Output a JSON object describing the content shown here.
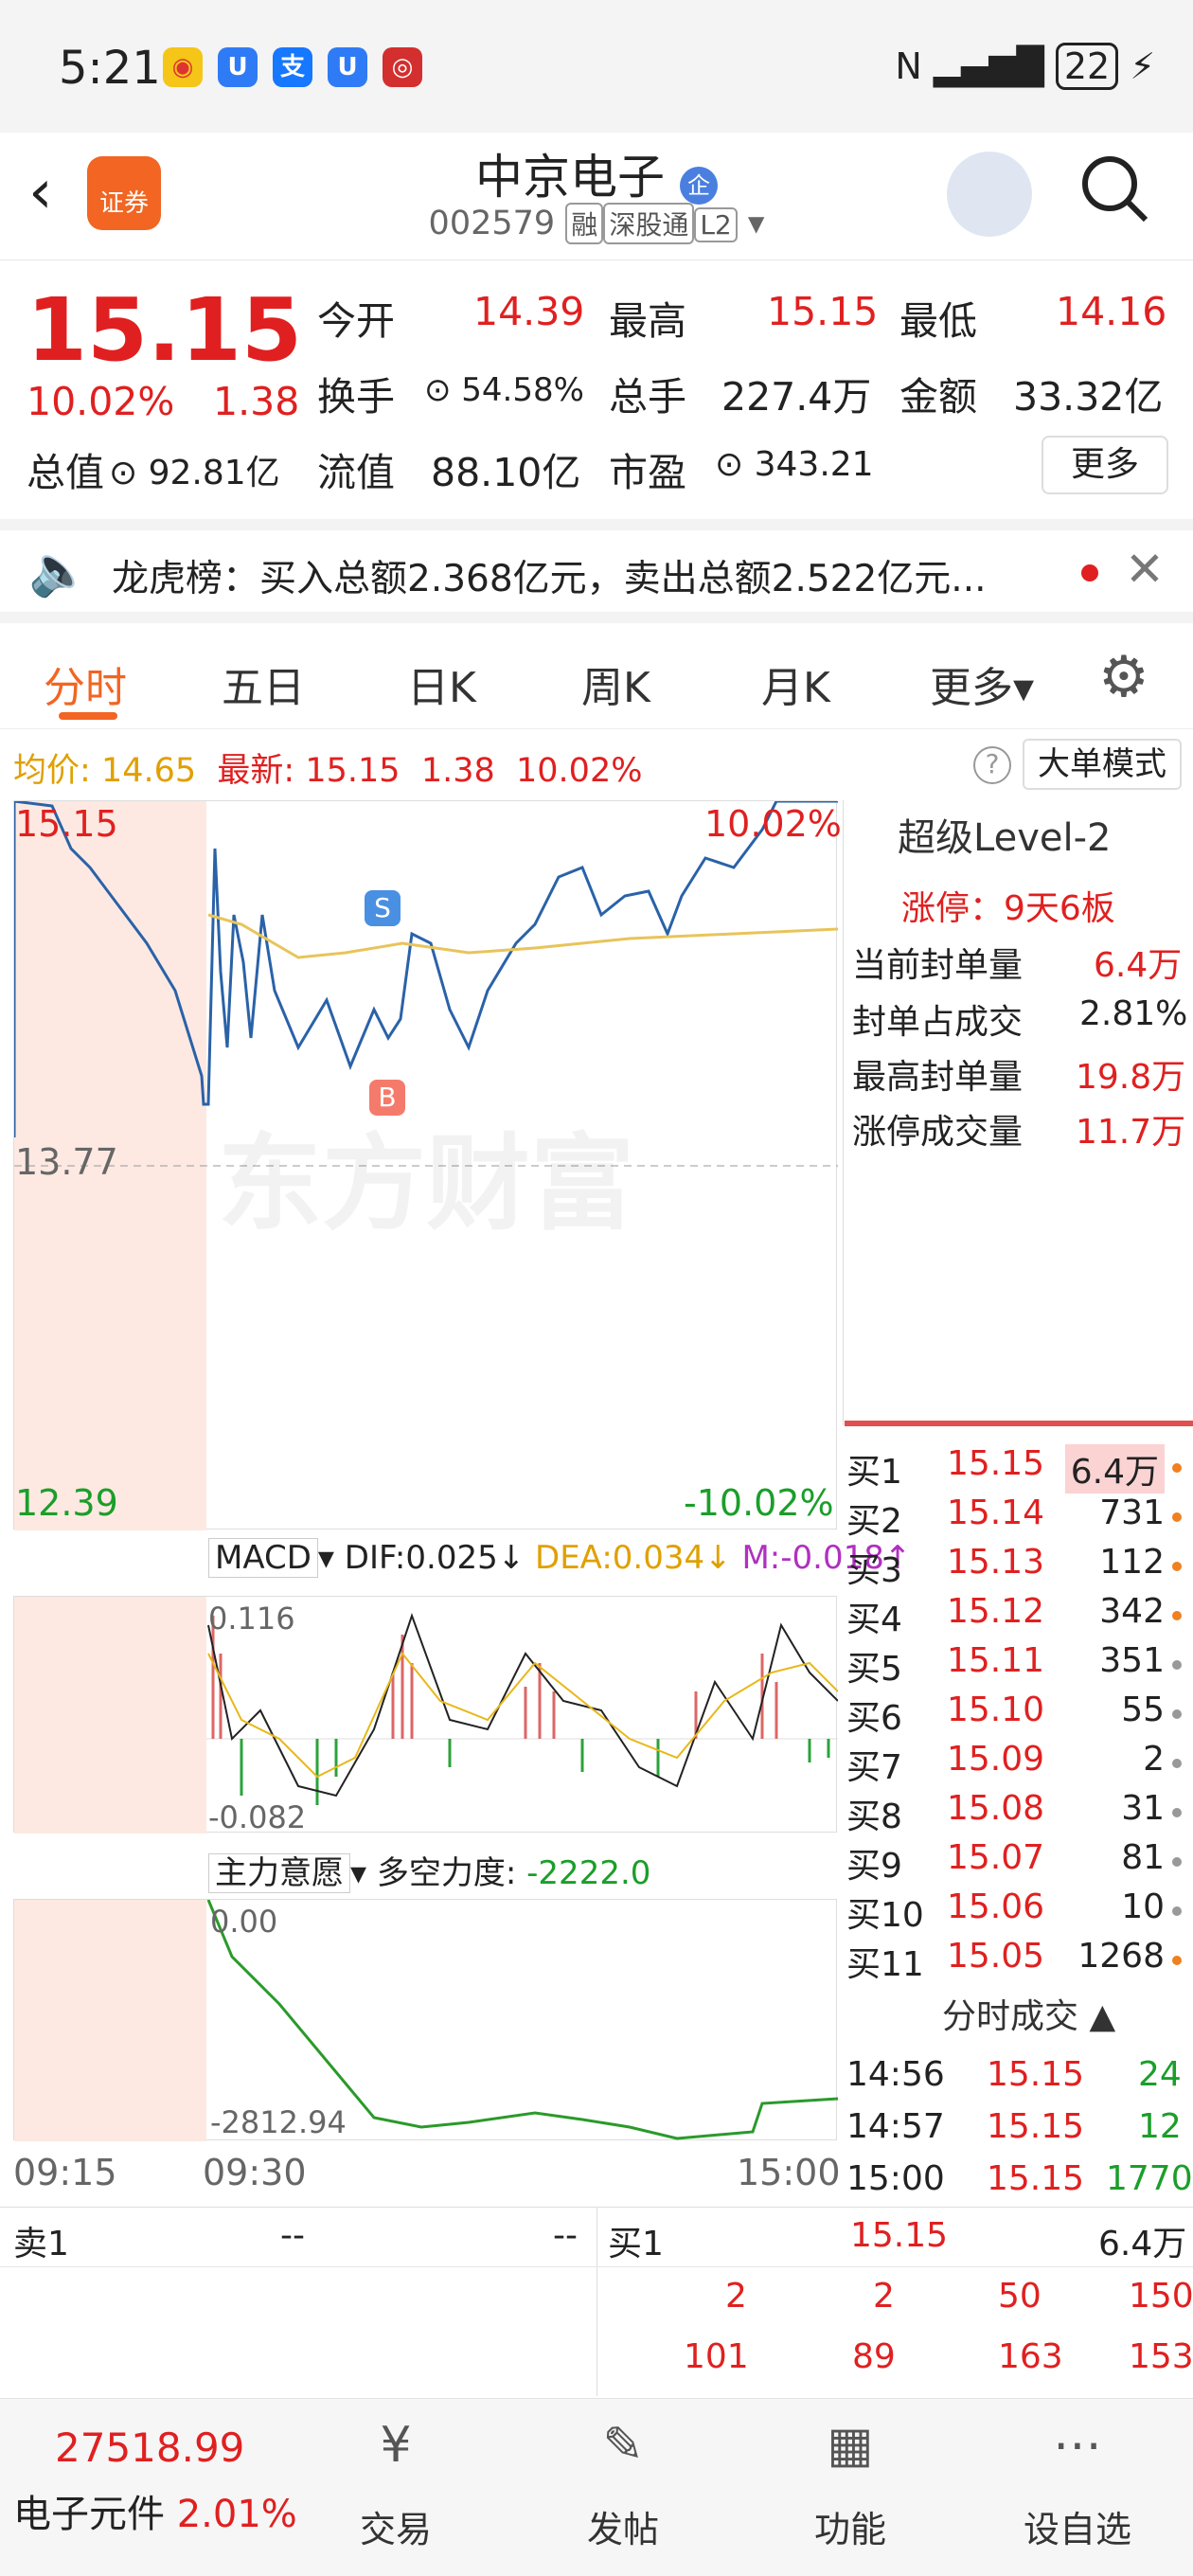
{
  "status_bar": {
    "time": "5:21",
    "battery": "22"
  },
  "header": {
    "title": "中京电子",
    "code": "002579",
    "tags": [
      "融",
      "深股通",
      "L2"
    ]
  },
  "quote": {
    "price": "15.15",
    "change_pct": "10.02%",
    "change": "1.38",
    "open_label": "今开",
    "open": "14.39",
    "high_label": "最高",
    "high": "15.15",
    "low_label": "最低",
    "low": "14.16",
    "turnover_label": "换手",
    "turnover": "54.58%",
    "volume_label": "总手",
    "volume": "227.4万",
    "amount_label": "金额",
    "amount": "33.32亿",
    "mcap_label": "总值",
    "mcap": "92.81亿",
    "float_label": "流值",
    "float": "88.10亿",
    "pe_label": "市盈",
    "pe": "343.21",
    "more_button": "更多"
  },
  "notice": {
    "text": "龙虎榜：买入总额2.368亿元，卖出总额2.522亿元..."
  },
  "tabs": [
    "分时",
    "五日",
    "日K",
    "周K",
    "月K",
    "更多"
  ],
  "chart_info": {
    "avg_label": "均价:",
    "avg": "14.65",
    "latest_label": "最新:",
    "latest": "15.15",
    "chg": "1.38",
    "pct": "10.02%",
    "mode_button": "大单模式"
  },
  "chart_labels": {
    "top_price": "15.15",
    "mid_price": "13.77",
    "bottom_price": "12.39",
    "top_pct": "10.02%",
    "bottom_pct": "-10.02%",
    "watermark": "东方财富"
  },
  "macd": {
    "label": "MACD",
    "dif": "DIF:0.025",
    "dea": "DEA:0.034",
    "m": "M:-0.018",
    "top": "0.116",
    "bottom": "-0.082"
  },
  "zlyy": {
    "label": "主力意愿",
    "force": "多空力度:",
    "force_val": "-2222.0",
    "top": "0.00",
    "bottom": "-2812.94"
  },
  "time_axis": [
    "09:15",
    "09:30",
    "15:00"
  ],
  "level2": {
    "title": "超级Level-2",
    "limit": "涨停：9天6板",
    "rows": [
      {
        "k": "当前封单量",
        "v": "6.4万"
      },
      {
        "k": "封单占成交",
        "v": "2.81%"
      },
      {
        "k": "最高封单量",
        "v": "19.8万"
      },
      {
        "k": "涨停成交量",
        "v": "11.7万"
      }
    ]
  },
  "orderbook": [
    {
      "l": "买1",
      "p": "15.15",
      "v": "6.4万"
    },
    {
      "l": "买2",
      "p": "15.14",
      "v": "731"
    },
    {
      "l": "买3",
      "p": "15.13",
      "v": "112"
    },
    {
      "l": "买4",
      "p": "15.12",
      "v": "342"
    },
    {
      "l": "买5",
      "p": "15.11",
      "v": "351"
    },
    {
      "l": "买6",
      "p": "15.10",
      "v": "55"
    },
    {
      "l": "买7",
      "p": "15.09",
      "v": "2"
    },
    {
      "l": "买8",
      "p": "15.08",
      "v": "31"
    },
    {
      "l": "买9",
      "p": "15.07",
      "v": "81"
    },
    {
      "l": "买10",
      "p": "15.06",
      "v": "10"
    },
    {
      "l": "买11",
      "p": "15.05",
      "v": "1268"
    }
  ],
  "ticks_title": "分时成交",
  "ticks": [
    {
      "t": "14:56",
      "p": "15.15",
      "v": "24"
    },
    {
      "t": "14:57",
      "p": "15.15",
      "v": "12"
    },
    {
      "t": "15:00",
      "p": "15.15",
      "v": "1770"
    }
  ],
  "queue": {
    "sell_label": "卖1",
    "sell_p": "--",
    "sell_v": "--",
    "buy_label": "买1",
    "buy_p": "15.15",
    "buy_v": "6.4万",
    "row1": [
      "2",
      "2",
      "50",
      "150"
    ],
    "row2": [
      "101",
      "89",
      "163",
      "153"
    ]
  },
  "bottom": {
    "index": "27518.99",
    "sector": "电子元件",
    "sector_pct": "2.01%",
    "nav": [
      "交易",
      "发帖",
      "功能",
      "设自选"
    ]
  }
}
